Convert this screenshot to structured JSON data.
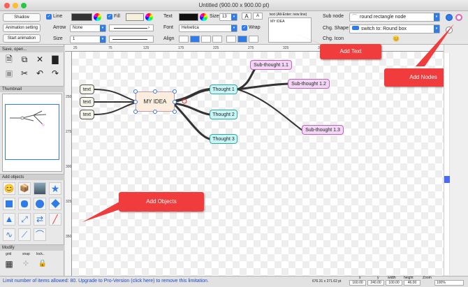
{
  "window": {
    "title": "Untitled (900.00 x 900.00 pt)"
  },
  "toolbar": {
    "shadow": "Shadow",
    "animation_setting": "Animation setting",
    "start_animation": "Start animation",
    "line": "Line",
    "fill": "Fill",
    "arrow": "Arrow",
    "arrow_value": "None",
    "size": "Size",
    "size_value": "1",
    "text": "Text",
    "font_size_label": "Size",
    "font_size": "13",
    "font": "Font",
    "font_value": "Helvetica",
    "wrap": "Wrap",
    "align": "Align",
    "text_input_label": "text (Alt-Enter: new line)",
    "text_input_value": "MY IDEA",
    "sub_node": "Sub node",
    "sub_node_value": "round rectangle node",
    "chg_shape": "Chg. Shape",
    "chg_shape_value": "switch to: Round box",
    "chg_icon": "Chg. Icon"
  },
  "left_panel": {
    "save_open": "Save, open...",
    "thumbnail": "Thumbnail",
    "add_objects": "Add objects",
    "modify": "Modify",
    "grid": "grid",
    "snap": "snap",
    "lock": "lock.."
  },
  "ruler": {
    "top": [
      "25",
      "75",
      "125",
      "175",
      "225",
      "275",
      "325",
      "375",
      "425"
    ],
    "left": [
      "250",
      "275",
      "300",
      "325",
      "350",
      "375",
      "400",
      "425"
    ]
  },
  "mindmap": {
    "center": "MY IDEA",
    "left_nodes": [
      "text",
      "text",
      "text"
    ],
    "thoughts": [
      "Thought 1",
      "Thought 2",
      "Thought 3"
    ],
    "subthoughts": [
      "Sub-thought 1.1",
      "Sub-thought 1.2",
      "Sub-thought 1.3"
    ]
  },
  "callouts": {
    "add_text": "Add Text",
    "add_nodes": "Add Nodes",
    "add_objects": "Add Objects"
  },
  "status": {
    "message": "Limit number of items allowed: 80. Upgrade to Pro-Version (click here) to remove this limitation.",
    "coords": "676.31 x 271.62 pt",
    "x_label": "x",
    "x": "160.00",
    "y_label": "y",
    "y": "240.00",
    "width_label": "width",
    "width": "100.00",
    "height_label": "height",
    "height": "46.00",
    "zoom_label": "Zoom",
    "zoom": "100%"
  },
  "colors": {
    "accent": "#2f7be8",
    "callout": "#f03c3c",
    "thought_fill": "#c8f5f8",
    "subthought_fill": "#f3d6f5",
    "center_fill": "#fbeede"
  }
}
